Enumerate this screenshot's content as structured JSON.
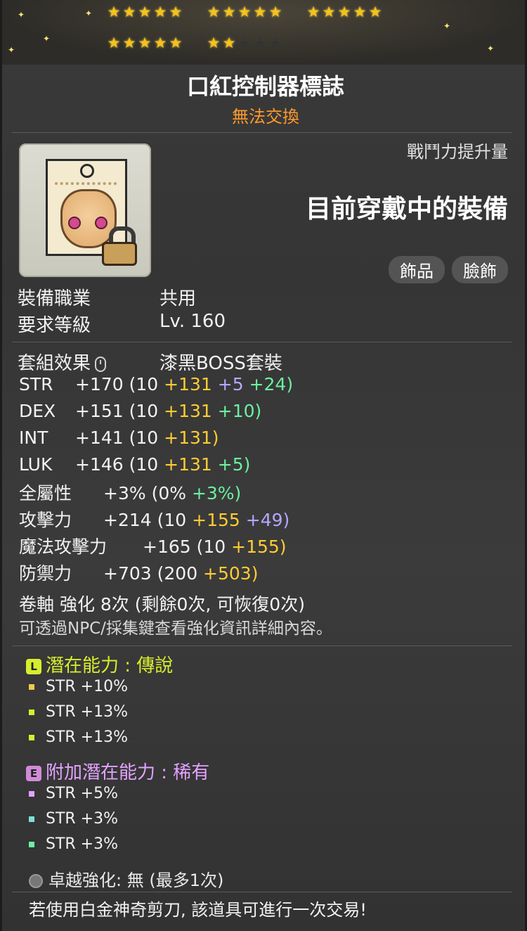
{
  "stars": {
    "filled": 22,
    "total": 25
  },
  "title": "口紅控制器標誌",
  "subtitle": "無法交換",
  "combat": {
    "label": "戰鬥力提升量",
    "value": "目前穿戴中的裝備"
  },
  "tags": [
    "飾品",
    "臉飾"
  ],
  "equip": {
    "job_label": "裝備職業",
    "job_value": "共用",
    "level_label": "要求等級",
    "level_value": "Lv. 160"
  },
  "set": {
    "label": "套組效果",
    "value": "漆黑BOSS套裝"
  },
  "stats": [
    {
      "name": "STR",
      "total": "+170",
      "base": "(10",
      "parts": [
        {
          "t": "+131",
          "c": "y"
        },
        {
          "t": "+5",
          "c": "p"
        },
        {
          "t": "+24)",
          "c": "g"
        }
      ]
    },
    {
      "name": "DEX",
      "total": "+151",
      "base": "(10",
      "parts": [
        {
          "t": "+131",
          "c": "y"
        },
        {
          "t": "+10)",
          "c": "g"
        }
      ]
    },
    {
      "name": "INT",
      "total": "+141",
      "base": "(10",
      "parts": [
        {
          "t": "+131)",
          "c": "y"
        }
      ]
    },
    {
      "name": "LUK",
      "total": "+146",
      "base": "(10",
      "parts": [
        {
          "t": "+131",
          "c": "y"
        },
        {
          "t": "+5)",
          "c": "g"
        }
      ]
    },
    {
      "name": "全屬性",
      "total": "+3%",
      "base": "(0%",
      "parts": [
        {
          "t": "+3%)",
          "c": "g"
        }
      ]
    },
    {
      "name": "攻擊力",
      "total": "+214",
      "base": "(10",
      "parts": [
        {
          "t": "+155",
          "c": "y"
        },
        {
          "t": "+49)",
          "c": "p"
        }
      ]
    },
    {
      "name": "魔法攻擊力",
      "total": "+165",
      "base": "(10",
      "parts": [
        {
          "t": "+155)",
          "c": "y"
        }
      ]
    },
    {
      "name": "防禦力",
      "total": "+703",
      "base": "(200",
      "parts": [
        {
          "t": "+503)",
          "c": "y"
        }
      ]
    }
  ],
  "scroll": {
    "line1": "卷軸 強化 8次 (剩餘0次, 可恢復0次)",
    "line2": "可透過NPC/採集鍵查看強化資訊詳細內容。"
  },
  "potential": {
    "badge": "L",
    "title": "潛在能力 : 傳說",
    "lines": [
      "STR +10%",
      "STR +13%",
      "STR +13%"
    ],
    "color": "#d7ee2e"
  },
  "additional": {
    "badge": "E",
    "title": "附加潛在能力 : 稀有",
    "lines": [
      "STR +5%",
      "STR +3%",
      "STR +3%"
    ],
    "color": "#e3a2ff"
  },
  "excellence": "卓越強化:  無 (最多1次)",
  "trade_note": "若使用白金神奇剪刀, 該道具可進行一次交易!"
}
